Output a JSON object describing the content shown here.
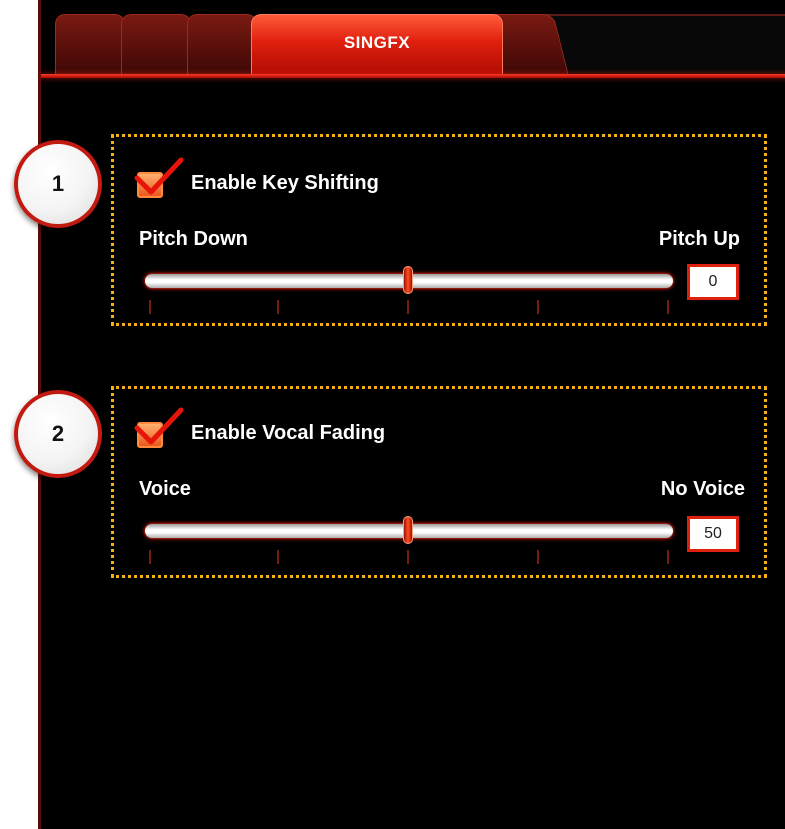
{
  "tabs": [
    {
      "label": "",
      "active": false
    },
    {
      "label": "",
      "active": false
    },
    {
      "label": "",
      "active": false
    },
    {
      "label": "SINGFX",
      "active": true
    },
    {
      "label": "",
      "active": false
    }
  ],
  "sections": [
    {
      "callout": "1",
      "checkbox_label": "Enable Key Shifting",
      "checked": true,
      "min_label": "Pitch Down",
      "max_label": "Pitch Up",
      "value": "0",
      "slider_position": 0.5
    },
    {
      "callout": "2",
      "checkbox_label": "Enable Vocal Fading",
      "checked": true,
      "min_label": "Voice",
      "max_label": "No Voice",
      "value": "50",
      "slider_position": 0.5
    }
  ],
  "colors": {
    "accent": "#e0200e",
    "dotted_outline": "#f5b014",
    "background": "#000000"
  }
}
